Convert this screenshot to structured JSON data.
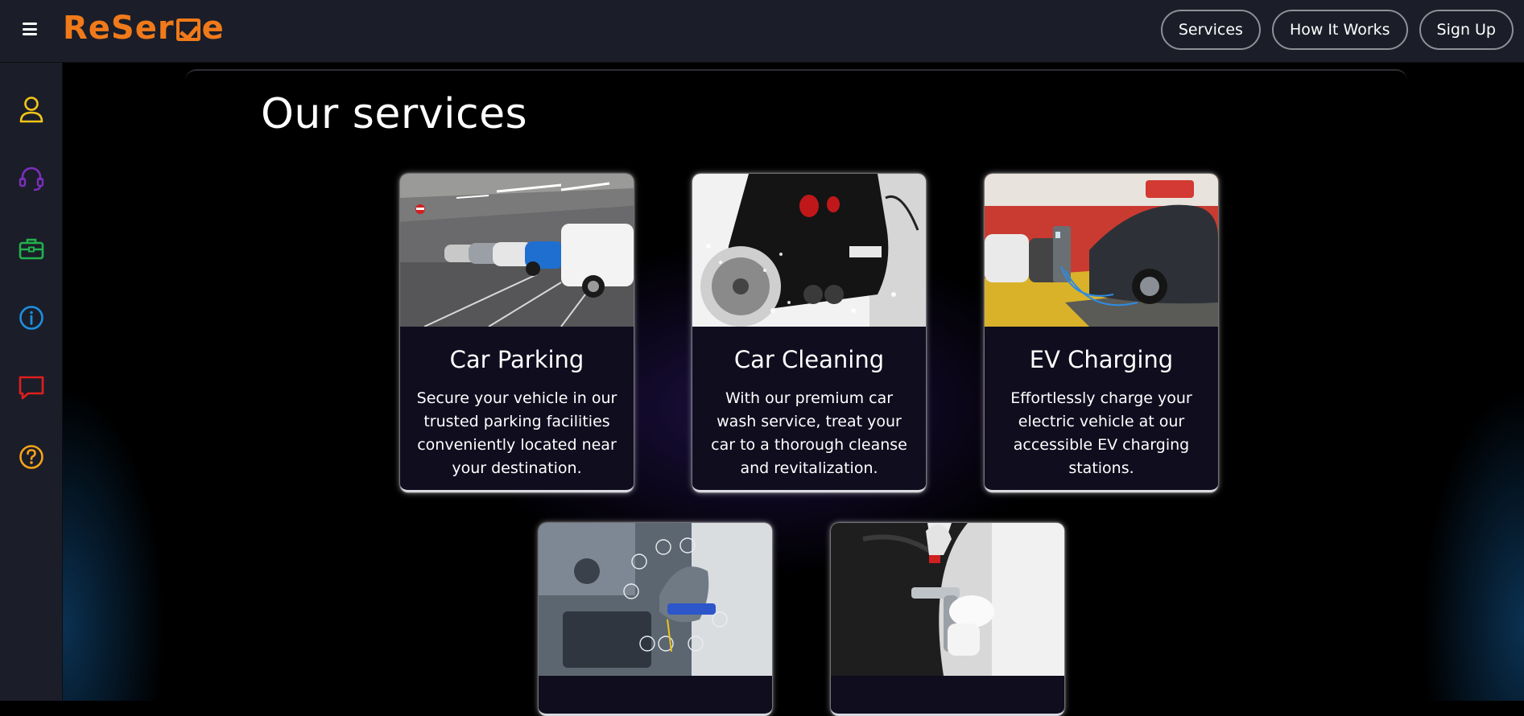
{
  "app": {
    "logo_text_1": "ReSer",
    "logo_text_2": "e"
  },
  "nav": {
    "items": [
      {
        "label": "Services"
      },
      {
        "label": "How It Works"
      },
      {
        "label": "Sign Up"
      }
    ]
  },
  "sidebar": {
    "items": [
      {
        "icon": "user-icon",
        "color": "#f5c518"
      },
      {
        "icon": "headset-icon",
        "color": "#7b2fbe"
      },
      {
        "icon": "briefcase-icon",
        "color": "#22b14c"
      },
      {
        "icon": "info-icon",
        "color": "#1e8fe0"
      },
      {
        "icon": "chat-icon",
        "color": "#e01e1e"
      },
      {
        "icon": "help-icon",
        "color": "#f5a31a"
      }
    ]
  },
  "main": {
    "title": "Our services",
    "cards": [
      {
        "title": "Car Parking",
        "description": "Secure your vehicle in our trusted parking facilities conveniently located near your destination.",
        "image": "parking-garage-photo"
      },
      {
        "title": "Car Cleaning",
        "description": "With our premium car wash service, treat your car to a thorough cleanse and revitalization.",
        "image": "car-wash-photo"
      },
      {
        "title": "EV Charging",
        "description": "Effortlessly charge your electric vehicle at our accessible EV charging stations.",
        "image": "ev-charging-photo"
      },
      {
        "title": "",
        "description": "",
        "image": "engine-repair-photo"
      },
      {
        "title": "",
        "description": "",
        "image": "spray-painting-photo"
      }
    ]
  },
  "colors": {
    "accent": "#f07a1a",
    "topbar": "#1b1e29",
    "background": "#000000"
  }
}
